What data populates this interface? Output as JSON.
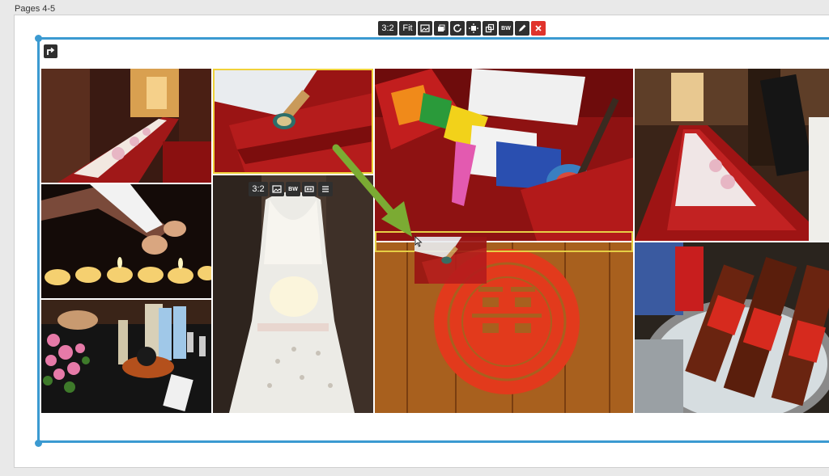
{
  "page_label": "Pages 4-5",
  "page_toolbar": {
    "ratio_label": "3:2",
    "fit_label": "Fit",
    "bw_label": "BW",
    "icons": [
      "image-swap-icon",
      "stack-icon",
      "rotate-icon",
      "move-icon",
      "link-icon",
      "pencil-icon",
      "close-icon"
    ]
  },
  "cell_toolbar": {
    "ratio_label": "3:2",
    "bw_label": "BW",
    "icons": [
      "image-swap-icon",
      "fit-width-icon",
      "menu-icon"
    ]
  },
  "colors": {
    "selection_blue": "#3b9ad1",
    "selection_yellow": "#f0d23a",
    "drag_arrow": "#7bab33",
    "close_red": "#e0332c",
    "toolbar_dark": "#2f2f2f"
  },
  "photos": [
    {
      "id": "banquet-hall-left",
      "subject": "banquet hall long table"
    },
    {
      "id": "prayer-wheel",
      "subject": "prayer wheel on red napkin"
    },
    {
      "id": "table-ribbons",
      "subject": "colorful ribbons on red table"
    },
    {
      "id": "banquet-hall-right",
      "subject": "banquet hall with menu"
    },
    {
      "id": "candles",
      "subject": "lighting butter lamps"
    },
    {
      "id": "wedding-dress",
      "subject": "white lace wedding dress"
    },
    {
      "id": "double-happiness",
      "subject": "red double happiness paper cut"
    },
    {
      "id": "beer-bucket",
      "subject": "beer bottles in ice bucket"
    },
    {
      "id": "table-drinks",
      "subject": "drinks and flowers on table"
    }
  ]
}
